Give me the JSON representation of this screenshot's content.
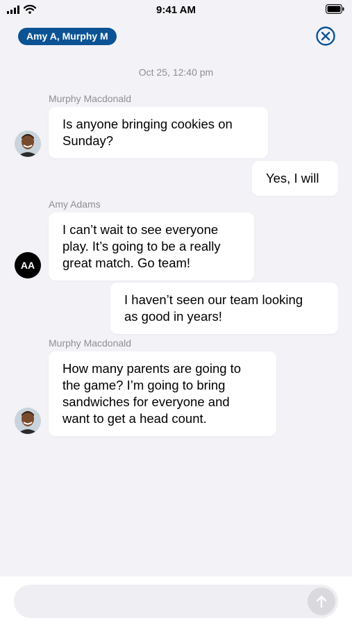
{
  "status_bar": {
    "time": "9:41 AM",
    "signal_icon": "cellular-signal-icon",
    "wifi_icon": "wifi-icon",
    "battery_icon": "battery-icon"
  },
  "header": {
    "participants": "Amy A, Murphy M",
    "close_icon": "close-circle-icon",
    "accent_color": "#0b5394"
  },
  "conversation": {
    "timestamp": "Oct 25, 12:40 pm",
    "messages": [
      {
        "sender": "Murphy Macdonald",
        "direction": "incoming",
        "avatar": "photo",
        "text": "Is anyone bringing cookies on\nSunday?"
      },
      {
        "direction": "outgoing",
        "text": "Yes, I will"
      },
      {
        "sender": "Amy Adams",
        "direction": "incoming",
        "avatar_initials": "AA",
        "text": "I can’t wait to see everyone\nplay. It’s going to be a really\ngreat match. Go team!"
      },
      {
        "direction": "outgoing",
        "text": "I haven’t seen our team looking\nas good in years!"
      },
      {
        "sender": "Murphy Macdonald",
        "direction": "incoming",
        "avatar": "photo",
        "text": "How many parents are going to\nthe game? I’m going to bring\nsandwiches for everyone and\nwant to get a head count."
      }
    ]
  },
  "composer": {
    "placeholder": "",
    "value": "",
    "send_icon": "arrow-up-icon"
  }
}
